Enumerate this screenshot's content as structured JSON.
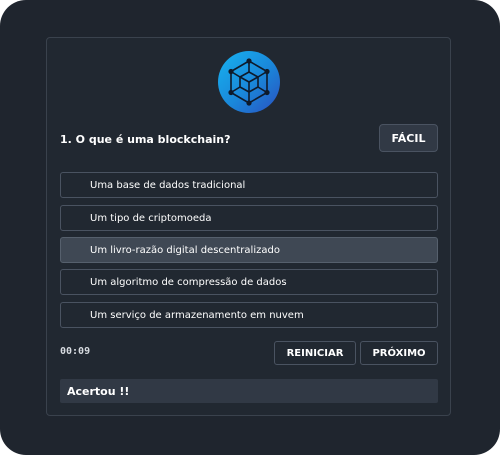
{
  "logo": {
    "icon": "blockchain-cube-icon",
    "gradient": [
      "#17b3f0",
      "#2a4fc0"
    ]
  },
  "quiz": {
    "question": "1. O que é uma blockchain?",
    "difficulty": "FÁCIL",
    "options": [
      {
        "label": "Uma base de dados tradicional",
        "selected": false
      },
      {
        "label": "Um tipo de criptomoeda",
        "selected": false
      },
      {
        "label": "Um livro-razão digital descentralizado",
        "selected": true
      },
      {
        "label": "Um algoritmo de compressão de dados",
        "selected": false
      },
      {
        "label": "Um serviço de armazenamento em nuvem",
        "selected": false
      }
    ],
    "timer": "00:09",
    "restart_label": "REINICIAR",
    "next_label": "PRÓXIMO",
    "feedback": "Acertou !!"
  },
  "colors": {
    "background": "#1f252e",
    "card": "#212831",
    "selected_option": "#3f4854",
    "border": "#4a5361"
  }
}
